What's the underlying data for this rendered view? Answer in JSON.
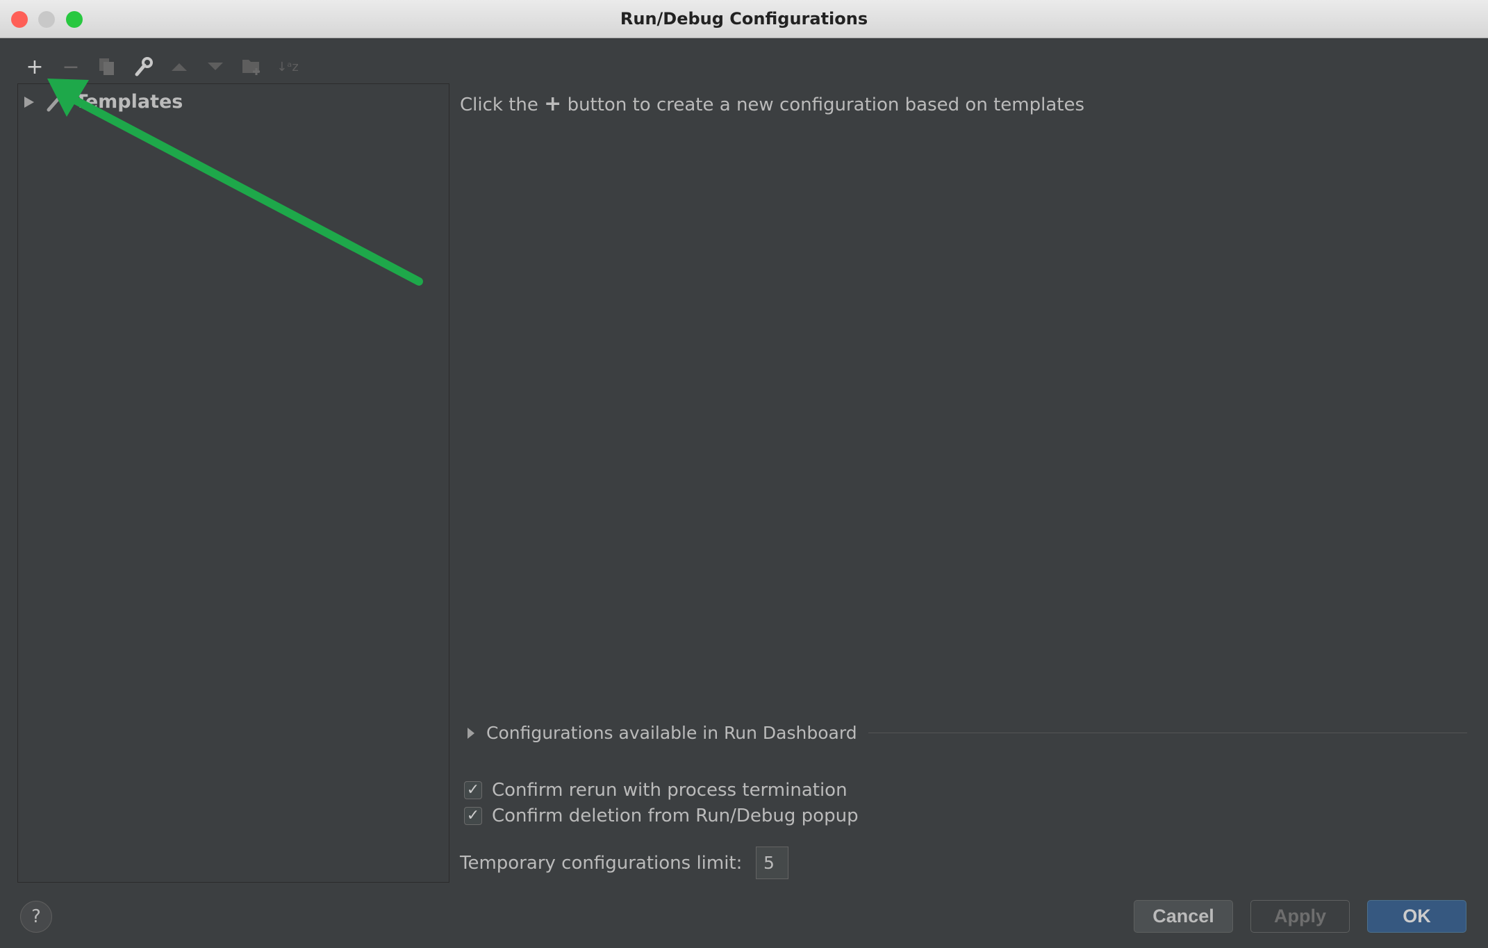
{
  "window": {
    "title": "Run/Debug Configurations"
  },
  "toolbar": {
    "icons": [
      "add-icon",
      "remove-icon",
      "copy-icon",
      "wrench-icon",
      "move-up-icon",
      "move-down-icon",
      "new-folder-icon",
      "sort-icon"
    ]
  },
  "tree": {
    "items": [
      {
        "label": "Templates",
        "expanded": false
      }
    ]
  },
  "main": {
    "hint_prefix": "Click the",
    "hint_plus": "+",
    "hint_suffix": "button to create a new configuration based on templates"
  },
  "dashboard": {
    "label": "Configurations available in Run Dashboard"
  },
  "options": [
    {
      "label": "Confirm rerun with process termination",
      "checked": true
    },
    {
      "label": "Confirm deletion from Run/Debug popup",
      "checked": true
    }
  ],
  "temp_limit": {
    "label": "Temporary configurations limit:",
    "value": "5"
  },
  "buttons": {
    "help": "?",
    "cancel": "Cancel",
    "apply": "Apply",
    "ok": "OK"
  },
  "colors": {
    "background": "#3c3f41",
    "ok_button": "#365880",
    "annotation_arrow": "#1ea84a"
  }
}
